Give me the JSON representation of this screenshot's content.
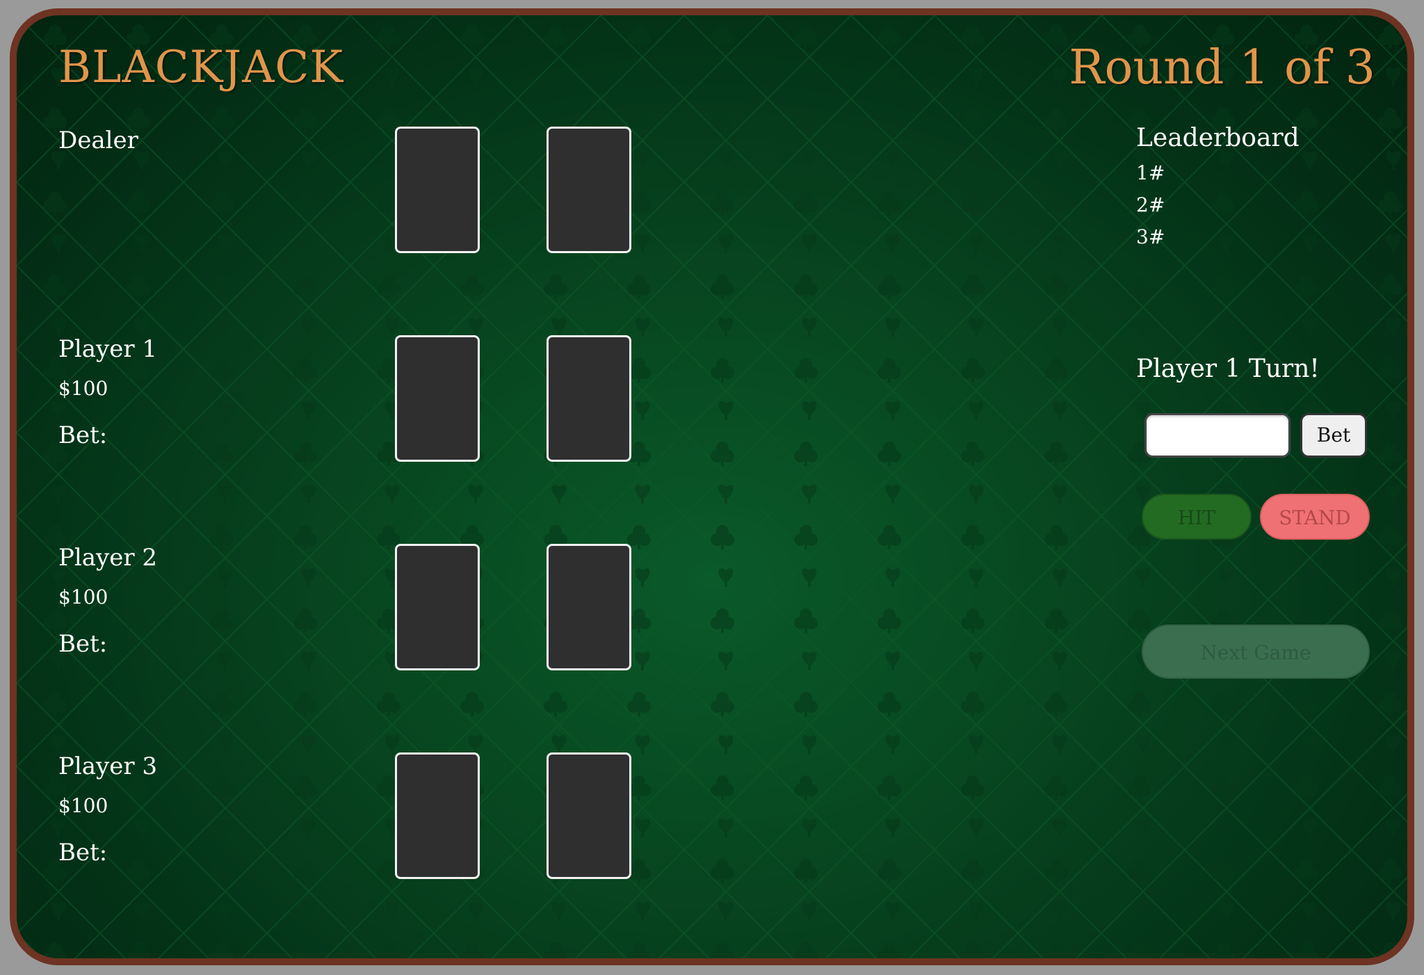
{
  "header": {
    "title": "BLACKJACK",
    "round": "Round 1 of 3"
  },
  "dealer": {
    "label": "Dealer"
  },
  "players": [
    {
      "name": "Player 1",
      "money": "$100",
      "bet_label": "Bet:"
    },
    {
      "name": "Player 2",
      "money": "$100",
      "bet_label": "Bet:"
    },
    {
      "name": "Player 3",
      "money": "$100",
      "bet_label": "Bet:"
    }
  ],
  "leaderboard": {
    "title": "Leaderboard",
    "rows": [
      "1#",
      "2#",
      "3#"
    ]
  },
  "controls": {
    "turn_text": "Player 1 Turn!",
    "bet_input_value": "",
    "bet_button": "Bet",
    "hit_button": "HIT",
    "stand_button": "STAND",
    "next_game_button": "Next Game"
  },
  "colors": {
    "title": "#e0954b",
    "felt": "#07441f",
    "border": "#6e3322",
    "card_back": "#2f2f2f"
  }
}
